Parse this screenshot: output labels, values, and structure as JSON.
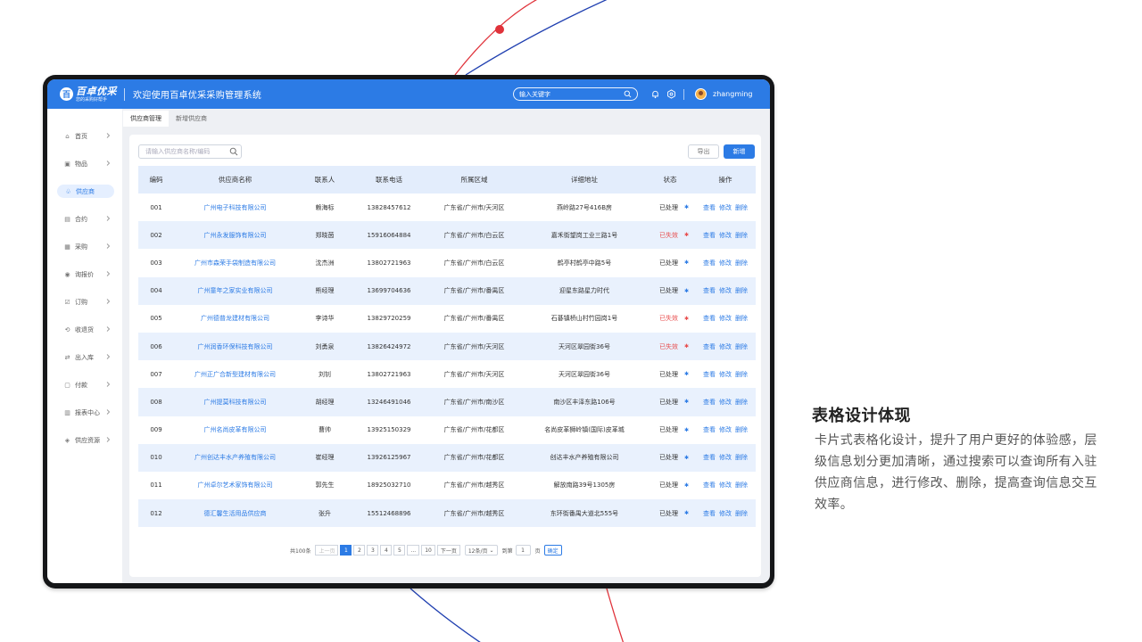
{
  "app": {
    "logo_mark": "百",
    "logo_name": "百卓优采",
    "logo_slogan": "您的采购好帮手",
    "title": "欢迎使用百卓优采采购管理系统",
    "search_placeholder": "输入关键字",
    "username": "zhangming"
  },
  "sidebar": {
    "items": [
      {
        "label": "首页",
        "icon": "home-icon",
        "glyph": "⌂"
      },
      {
        "label": "物品",
        "icon": "box-icon",
        "glyph": "▣"
      },
      {
        "label": "供应商",
        "icon": "supplier-icon",
        "glyph": "♧"
      },
      {
        "label": "合约",
        "icon": "contract-icon",
        "glyph": "▤"
      },
      {
        "label": "采购",
        "icon": "purchase-icon",
        "glyph": "▦"
      },
      {
        "label": "询报价",
        "icon": "quote-icon",
        "glyph": "◉"
      },
      {
        "label": "订购",
        "icon": "order-icon",
        "glyph": "☑"
      },
      {
        "label": "收退货",
        "icon": "return-icon",
        "glyph": "⟲"
      },
      {
        "label": "出入库",
        "icon": "warehouse-icon",
        "glyph": "⇄"
      },
      {
        "label": "付款",
        "icon": "payment-icon",
        "glyph": "▢"
      },
      {
        "label": "报表中心",
        "icon": "report-icon",
        "glyph": "▥"
      },
      {
        "label": "供应资源",
        "icon": "resource-icon",
        "glyph": "◈"
      }
    ],
    "active": "供应商"
  },
  "tabs": [
    "供应商管理",
    "新增供应商"
  ],
  "toolbar": {
    "search_placeholder": "请输入供应商名称/编码",
    "export_label": "导出",
    "new_label": "新增"
  },
  "table": {
    "headers": [
      "编码",
      "供应商名称",
      "联系人",
      "联系电话",
      "所属区域",
      "详细地址",
      "状态",
      "操作"
    ],
    "rows": [
      {
        "code": "001",
        "name": "广州电子科技有限公司",
        "contact": "赖海标",
        "phone": "13828457612",
        "region": "广东省/广州市/天河区",
        "address": "燕岭路27号416B房",
        "status": "已处理"
      },
      {
        "code": "002",
        "name": "广州永发服饰有限公司",
        "contact": "郑晓茵",
        "phone": "15916064884",
        "region": "广东省/广州市/白云区",
        "address": "嘉禾街望岗工业三路1号",
        "status": "已失效"
      },
      {
        "code": "003",
        "name": "广州市森荣手袋制造有限公司",
        "contact": "沈杰洲",
        "phone": "13802721963",
        "region": "广东省/广州市/白云区",
        "address": "鹤亭村鹤亭中路5号",
        "status": "已处理"
      },
      {
        "code": "004",
        "name": "广州童年之家实业有限公司",
        "contact": "熊经理",
        "phone": "13699704636",
        "region": "广东省/广州市/番禺区",
        "address": "迎星东路星力时代",
        "status": "已处理"
      },
      {
        "code": "005",
        "name": "广州德普龙建材有限公司",
        "contact": "李诗华",
        "phone": "13829720259",
        "region": "广东省/广州市/番禺区",
        "address": "石碁镇桥山村竹园岗1号",
        "status": "已失效"
      },
      {
        "code": "006",
        "name": "广州润香环保科技有限公司",
        "contact": "刘勇泉",
        "phone": "13826424972",
        "region": "广东省/广州市/天河区",
        "address": "天河区翠园街36号",
        "status": "已失效"
      },
      {
        "code": "007",
        "name": "广州正广合新型建材有限公司",
        "contact": "刘钊",
        "phone": "13802721963",
        "region": "广东省/广州市/天河区",
        "address": "天河区翠园街36号",
        "status": "已处理"
      },
      {
        "code": "008",
        "name": "广州提莫科技有限公司",
        "contact": "胡经理",
        "phone": "13246491046",
        "region": "广东省/广州市/南沙区",
        "address": "南沙区丰泽东路106号",
        "status": "已处理"
      },
      {
        "code": "009",
        "name": "广州名尚皮革有限公司",
        "contact": "曹帅",
        "phone": "13925150329",
        "region": "广东省/广州市/花都区",
        "address": "名尚皮革狮岭镇(国际)皮革城",
        "status": "已处理"
      },
      {
        "code": "010",
        "name": "广州创达丰水产养殖有限公司",
        "contact": "崔经理",
        "phone": "13926125967",
        "region": "广东省/广州市/花都区",
        "address": "创达丰水产养殖有限公司",
        "status": "已处理"
      },
      {
        "code": "011",
        "name": "广州卓尔艺术家饰有限公司",
        "contact": "郭先生",
        "phone": "18925032710",
        "region": "广东省/广州市/越秀区",
        "address": "解放南路39号1305房",
        "status": "已处理"
      },
      {
        "code": "012",
        "name": "德汇馨生活用品供应商",
        "contact": "张升",
        "phone": "15512468896",
        "region": "广东省/广州市/越秀区",
        "address": "东环街番禺大道北555号",
        "status": "已处理"
      }
    ],
    "ops": [
      "查看",
      "修改",
      "删除"
    ]
  },
  "pagination": {
    "total": "共100条",
    "prev": "上一页",
    "pages": [
      "1",
      "2",
      "3",
      "4",
      "5",
      "...",
      "10"
    ],
    "current": "1",
    "next": "下一页",
    "page_size": "12条/页",
    "goto_label": "到第",
    "goto_value": "1",
    "page_unit": "页",
    "confirm": "确定"
  },
  "side": {
    "title": "表格设计体现",
    "description": "卡片式表格化设计，提升了用户更好的体验感，层级信息划分更加清晰，通过搜索可以查询所有入驻供应商信息，进行修改、删除，提高查询信息交互效率。"
  },
  "colors": {
    "primary": "#2c7be5",
    "row_alt": "#e9f1fd",
    "invalid": "#e84c4c",
    "deco_red": "#e0323a",
    "deco_blue": "#1f3fb0"
  }
}
